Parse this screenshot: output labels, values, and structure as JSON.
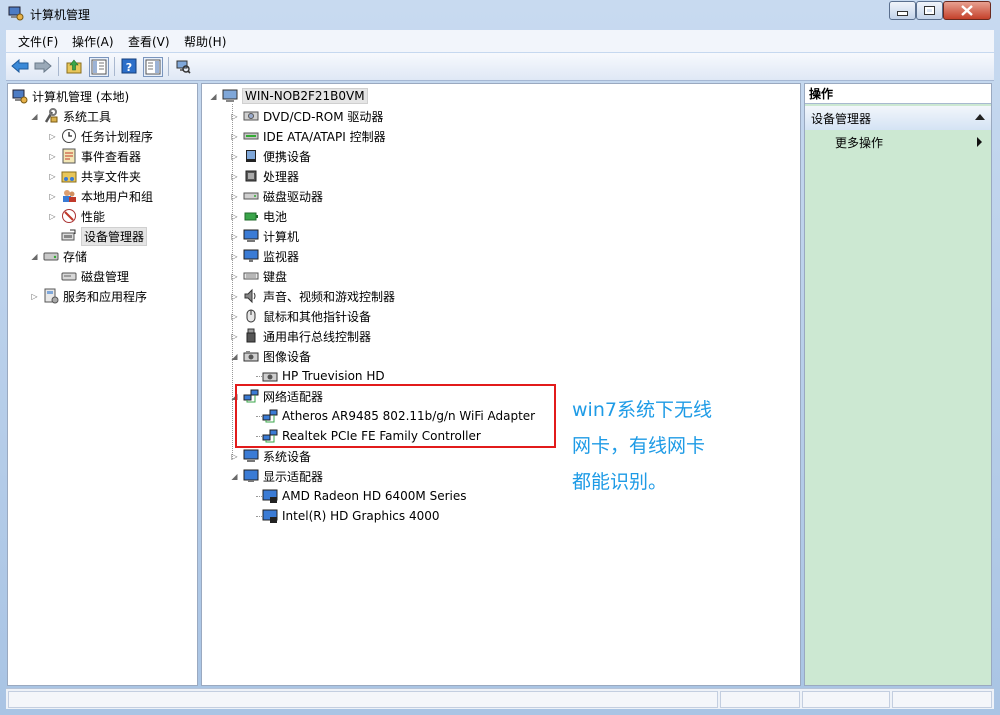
{
  "window": {
    "title": "计算机管理"
  },
  "menu": [
    "文件(F)",
    "操作(A)",
    "查看(V)",
    "帮助(H)"
  ],
  "left_tree": [
    {
      "label": "计算机管理 (本地)",
      "level": 0,
      "expander": "",
      "icon": "computer-management-icon"
    },
    {
      "label": "系统工具",
      "level": 1,
      "expander": "expanded",
      "icon": "system-tools-icon"
    },
    {
      "label": "任务计划程序",
      "level": 2,
      "expander": "collapsed",
      "icon": "task-scheduler-icon"
    },
    {
      "label": "事件查看器",
      "level": 2,
      "expander": "collapsed",
      "icon": "event-viewer-icon"
    },
    {
      "label": "共享文件夹",
      "level": 2,
      "expander": "collapsed",
      "icon": "shared-folders-icon"
    },
    {
      "label": "本地用户和组",
      "level": 2,
      "expander": "collapsed",
      "icon": "local-users-icon"
    },
    {
      "label": "性能",
      "level": 2,
      "expander": "collapsed",
      "icon": "performance-icon"
    },
    {
      "label": "设备管理器",
      "level": 2,
      "expander": "",
      "icon": "device-manager-icon",
      "selected": true
    },
    {
      "label": "存储",
      "level": 1,
      "expander": "expanded",
      "icon": "storage-icon"
    },
    {
      "label": "磁盘管理",
      "level": 2,
      "expander": "",
      "icon": "disk-management-icon"
    },
    {
      "label": "服务和应用程序",
      "level": 1,
      "expander": "collapsed",
      "icon": "services-apps-icon"
    }
  ],
  "device_tree": {
    "root": "WIN-NOB2F21B0VM",
    "categories": [
      {
        "label": "DVD/CD-ROM 驱动器",
        "expander": "collapsed",
        "icon": "dvd-drive-icon",
        "children": []
      },
      {
        "label": "IDE ATA/ATAPI 控制器",
        "expander": "collapsed",
        "icon": "ide-controller-icon",
        "children": []
      },
      {
        "label": "便携设备",
        "expander": "collapsed",
        "icon": "portable-device-icon",
        "children": []
      },
      {
        "label": "处理器",
        "expander": "collapsed",
        "icon": "processor-icon",
        "children": []
      },
      {
        "label": "磁盘驱动器",
        "expander": "collapsed",
        "icon": "disk-drive-icon",
        "children": []
      },
      {
        "label": "电池",
        "expander": "collapsed",
        "icon": "battery-icon",
        "children": []
      },
      {
        "label": "计算机",
        "expander": "collapsed",
        "icon": "computer-icon",
        "children": []
      },
      {
        "label": "监视器",
        "expander": "collapsed",
        "icon": "monitor-icon",
        "children": []
      },
      {
        "label": "键盘",
        "expander": "collapsed",
        "icon": "keyboard-icon",
        "children": []
      },
      {
        "label": "声音、视频和游戏控制器",
        "expander": "collapsed",
        "icon": "sound-icon",
        "children": []
      },
      {
        "label": "鼠标和其他指针设备",
        "expander": "collapsed",
        "icon": "mouse-icon",
        "children": []
      },
      {
        "label": "通用串行总线控制器",
        "expander": "collapsed",
        "icon": "usb-icon",
        "children": []
      },
      {
        "label": "图像设备",
        "expander": "expanded",
        "icon": "imaging-device-icon",
        "children": [
          "HP Truevision HD"
        ]
      },
      {
        "label": "网络适配器",
        "expander": "expanded",
        "icon": "network-adapter-icon",
        "children": [
          "Atheros AR9485 802.11b/g/n WiFi Adapter",
          "Realtek PCIe FE Family Controller"
        ]
      },
      {
        "label": "系统设备",
        "expander": "collapsed",
        "icon": "system-device-icon",
        "children": []
      },
      {
        "label": "显示适配器",
        "expander": "expanded",
        "icon": "display-adapter-icon",
        "children": [
          "AMD Radeon HD 6400M Series",
          "Intel(R) HD Graphics 4000"
        ]
      }
    ]
  },
  "actions": {
    "header": "操作",
    "section": "设备管理器",
    "more": "更多操作"
  },
  "annotation": {
    "lines": [
      "win7系统下无线",
      "网卡，有线网卡",
      "都能识别。"
    ],
    "color": "#1e9be6",
    "box_color": "#e21b1b"
  }
}
